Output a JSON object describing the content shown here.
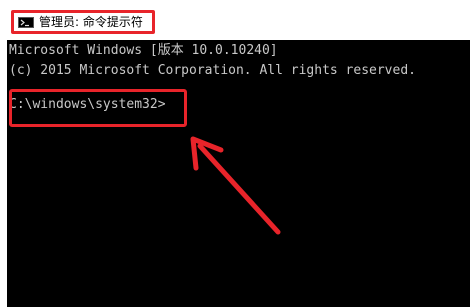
{
  "window": {
    "title": "管理员: 命令提示符",
    "icon": "console-icon"
  },
  "console": {
    "lines": [
      "Microsoft Windows [版本 10.0.10240]",
      "(c) 2015 Microsoft Corporation. All rights reserved.",
      "C:\\windows\\system32>"
    ]
  },
  "annotations": {
    "highlight_color": "#e8242a",
    "console_background": "#000000",
    "console_text_color": "#c8c8c8"
  }
}
